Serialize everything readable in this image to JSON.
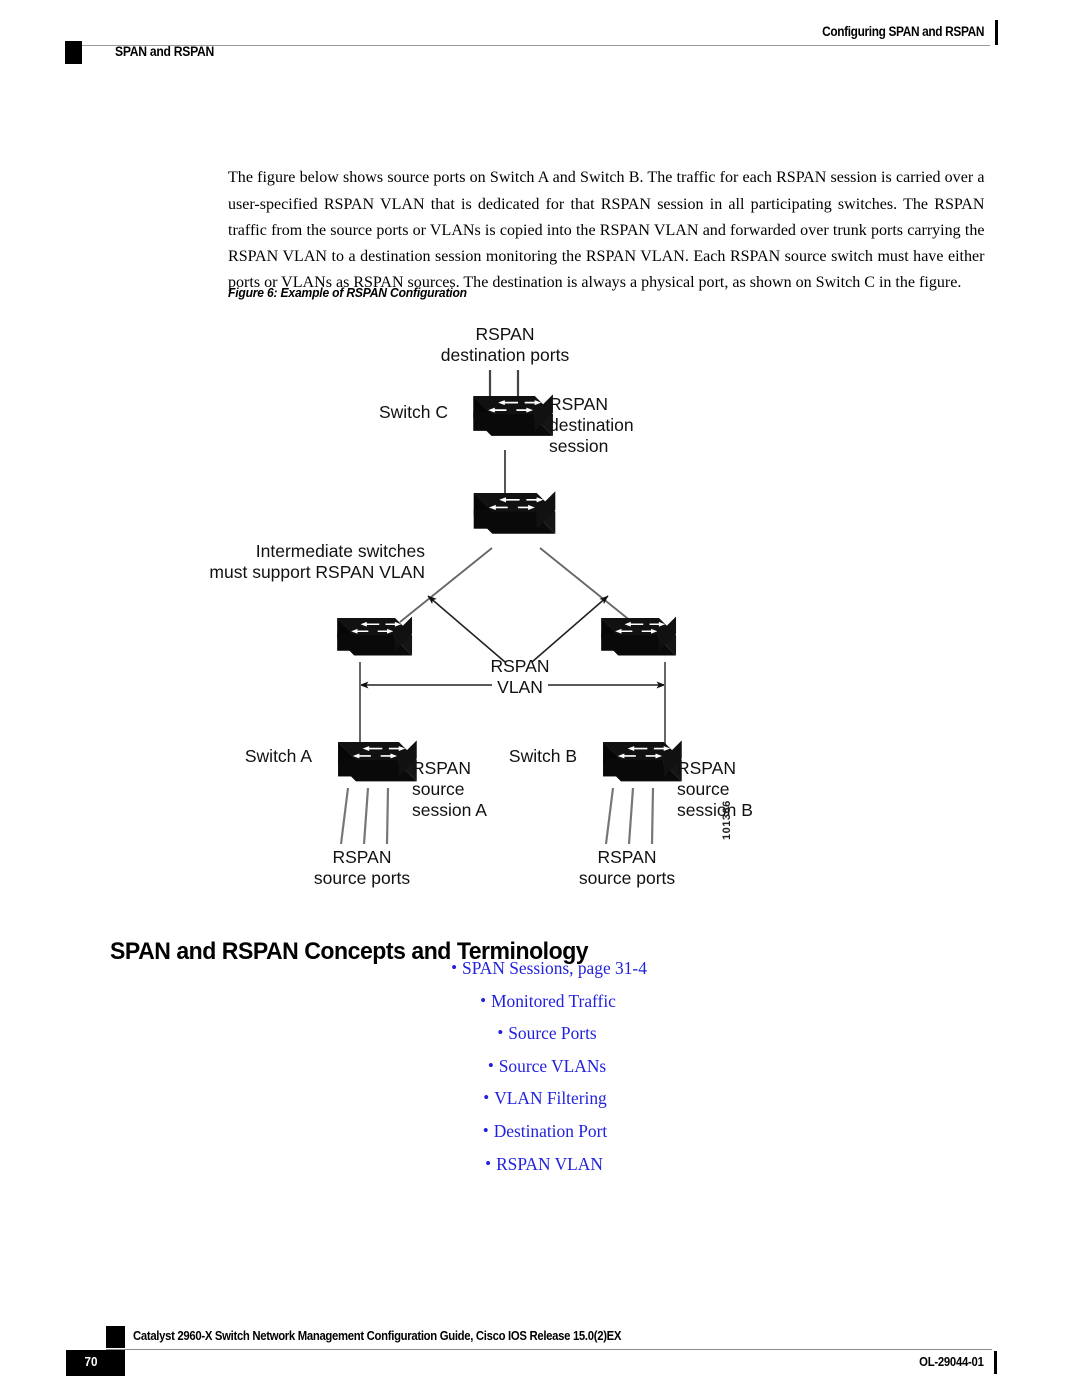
{
  "header": {
    "running_title": "Configuring SPAN and RSPAN",
    "section_title": "SPAN and RSPAN"
  },
  "main": {
    "paragraph": "The figure below shows source ports on Switch A and Switch B. The traffic for each RSPAN session is carried over a user-specified RSPAN VLAN that is dedicated for that RSPAN session in all participating switches. The RSPAN traffic from the source ports or VLANs is copied into the RSPAN VLAN and forwarded over trunk ports carrying the RSPAN VLAN to a destination session monitoring the RSPAN VLAN. Each RSPAN source switch must have either ports or VLANs as RSPAN sources. The destination is always a physical port, as shown on Switch C in the figure.",
    "figure_caption": "Figure 6: Example of RSPAN Configuration",
    "section_heading": "SPAN and RSPAN Concepts and Terminology"
  },
  "figure": {
    "id_number": "101366",
    "labels": {
      "dest_ports_line1": "RSPAN",
      "dest_ports_line2": "destination ports",
      "switch_c": "Switch C",
      "dest_session_line1": "RSPAN",
      "dest_session_line2": "destination",
      "dest_session_line3": "session",
      "intermediate_line1": "Intermediate switches",
      "intermediate_line2": "must support RSPAN VLAN",
      "rspan_vlan_line1": "RSPAN",
      "rspan_vlan_line2": "VLAN",
      "switch_a": "Switch A",
      "source_session_a_line1": "RSPAN",
      "source_session_a_line2": "source",
      "source_session_a_line3": "session A",
      "source_ports_a_line1": "RSPAN",
      "source_ports_a_line2": "source ports",
      "switch_b": "Switch B",
      "source_session_b_line1": "RSPAN",
      "source_session_b_line2": "source",
      "source_session_b_line3": "session B",
      "source_ports_b_line1": "RSPAN",
      "source_ports_b_line2": "source ports"
    }
  },
  "links": [
    {
      "label": "SPAN Sessions, page 31-4"
    },
    {
      "label": "Monitored Traffic"
    },
    {
      "label": "Source Ports"
    },
    {
      "label": "Source VLANs"
    },
    {
      "label": "VLAN Filtering"
    },
    {
      "label": "Destination Port"
    },
    {
      "label": "RSPAN VLAN"
    }
  ],
  "footer": {
    "doc_title": "Catalyst 2960-X Switch Network Management Configuration Guide, Cisco IOS Release 15.0(2)EX",
    "page_number": "70",
    "doc_number": "OL-29044-01"
  },
  "colors": {
    "link": "#2222dd",
    "rule": "#9a9a9a",
    "ink": "#000000"
  }
}
